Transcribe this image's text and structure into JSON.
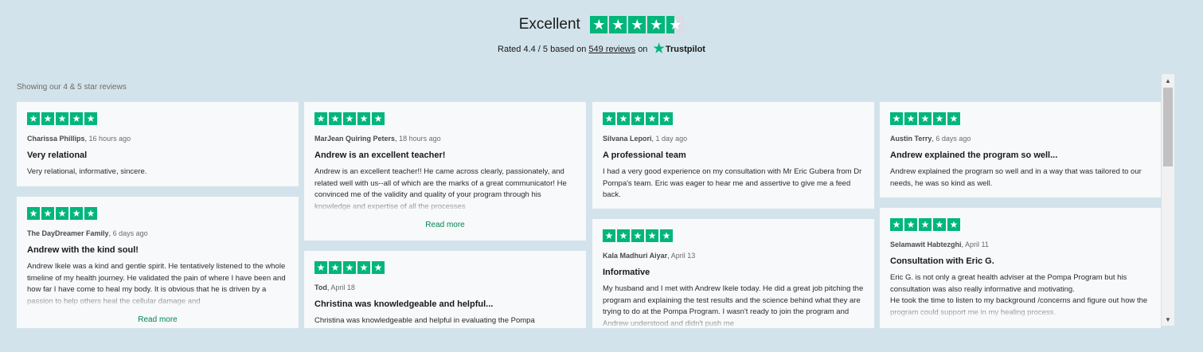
{
  "header": {
    "rating_word": "Excellent",
    "rated_prefix": "Rated 4.4 / 5 based on",
    "reviews_link": "549 reviews",
    "on_text": "on",
    "brand": "Trustpilot",
    "rating_value": 4.4,
    "accent_color": "#00b67a"
  },
  "filter_text": "Showing our 4 & 5 star reviews",
  "read_more": "Read more",
  "reviews": [
    {
      "author": "Charissa Phillips",
      "when": "16 hours ago",
      "title": "Very relational",
      "body": "Very relational, informative, sincere.",
      "stars": 5
    },
    {
      "author": "The DayDreamer Family",
      "when": "6 days ago",
      "title": "Andrew with the kind soul!",
      "body": "Andrew Ikele was a kind and gentle spirit. He tentatively listened to the whole timeline of my health journey. He validated the pain of where I have been and how far I have come to heal my body. It is obvious that he is driven by a passion to help others heal the cellular damage and",
      "stars": 5
    },
    {
      "author": "MarJean Quiring Peters",
      "when": "18 hours ago",
      "title": "Andrew is an excellent teacher!",
      "body": "Andrew is an excellent teacher!! He came across clearly, passionately, and related well with us--all of which are the marks of a great communicator! He convinced me of the validity and quality of your program through his knowledge and expertise of all the processes",
      "stars": 5
    },
    {
      "author": "Tod",
      "when": "April 18",
      "title": "Christina was knowledgeable and helpful...",
      "body": "Christina was knowledgeable and helpful in evaluating the Pompa",
      "stars": 5
    },
    {
      "author": "Silvana Lepori",
      "when": "1 day ago",
      "title": "A professional team",
      "body": "I had a very good experience on my consultation with Mr Eric Gubera from Dr Pompa's team. Eric was eager to hear me and assertive to give me a feed back.",
      "stars": 5
    },
    {
      "author": "Kala Madhuri Aiyar",
      "when": "April 13",
      "title": "Informative",
      "body": "My husband and I met with Andrew Ikele today. He did a great job pitching the program and explaining the test results and the science behind what they are trying to do at the Pompa Program. I wasn't ready to join the program and Andrew understood and didn't push me",
      "stars": 5
    },
    {
      "author": "Austin Terry",
      "when": "6 days ago",
      "title": "Andrew explained the program so well...",
      "body": "Andrew explained the program so well and in a way that was tailored to our needs, he was so kind as well.",
      "stars": 5
    },
    {
      "author": "Selamawit Habtezghi",
      "when": "April 11",
      "title": "Consultation with Eric G.",
      "body": "Eric G. is not only a great health adviser at the Pompa Program but his consultation was also really informative and motivating.\nHe took the time to listen to my background /concerns and figure out how the program could support me in my healing process.",
      "stars": 5
    }
  ],
  "icons": {
    "star": "star-icon",
    "trustpilot": "trustpilot-star-icon",
    "scroll_up": "arrow-up-icon",
    "scroll_down": "arrow-down-icon"
  }
}
